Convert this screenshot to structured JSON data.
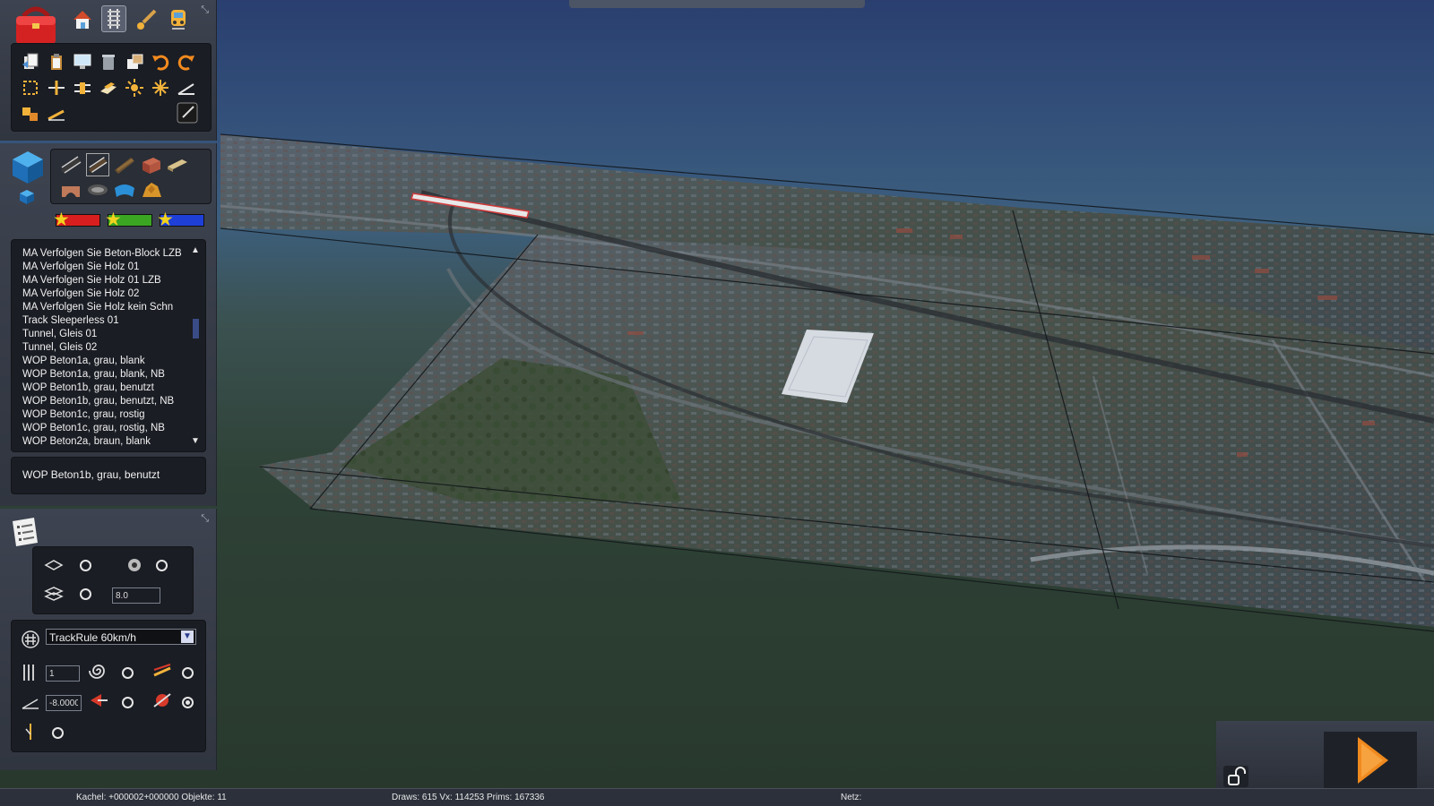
{
  "toolbar_top": {
    "icons": [
      "toolbox-icon",
      "home-icon",
      "track-icon",
      "brush-icon",
      "train-icon"
    ]
  },
  "tools_panel": {
    "row1": [
      "copy-icon",
      "paste-icon",
      "monitor-icon",
      "trash-icon",
      "screenshot-icon",
      "undo-icon",
      "redo-icon"
    ],
    "row2": [
      "select-rect-icon",
      "split-icon",
      "join-icon",
      "flatten-icon",
      "sun-icon",
      "crosshair-icon",
      "angle-icon"
    ],
    "row3": [
      "blocks-icon",
      "ruler-icon",
      "dark-square-icon"
    ]
  },
  "palette_panel": {
    "categories": [
      "rail-track-icon",
      "track-segment-icon",
      "wood-track-icon",
      "brick-icon",
      "plank-icon",
      "arch-icon",
      "coil-icon",
      "water-icon",
      "rock-icon"
    ],
    "favorites": [
      {
        "color": "#d81e1e"
      },
      {
        "color": "#3aa622"
      },
      {
        "color": "#1e3fd8"
      }
    ]
  },
  "asset_list": {
    "items": [
      "MA Verfolgen Sie Beton-Block LZB",
      "MA Verfolgen Sie Holz 01",
      "MA Verfolgen Sie Holz 01 LZB",
      "MA Verfolgen Sie Holz 02",
      "MA Verfolgen Sie Holz kein Schn",
      "Track Sleeperless 01",
      "Tunnel, Gleis 01",
      "Tunnel, Gleis 02",
      "WOP Beton1a, grau, blank",
      "WOP Beton1a, grau, blank, NB",
      "WOP Beton1b, grau, benutzt",
      "WOP Beton1b, grau, benutzt, NB",
      "WOP Beton1c, grau, rostig",
      "WOP Beton1c, grau, rostig, NB",
      "WOP Beton2a, braun, blank"
    ],
    "selected": "WOP Beton1b, grau, benutzt"
  },
  "properties": {
    "snap_value": "8.0",
    "track_rule": "TrackRule 60km/h",
    "track_count": "1",
    "gradient": "-8.0000"
  },
  "statusbar": {
    "kachel": "Kachel: +000002+000000  Objekte: 11",
    "draws": "Draws: 615 Vx: 114253 Prims: 167336",
    "netz": "Netz:"
  },
  "colors": {
    "panel": "#353a45",
    "play_accent": "#f08a1e",
    "sky": "#2a3f6f",
    "ground": "#2f4237"
  }
}
